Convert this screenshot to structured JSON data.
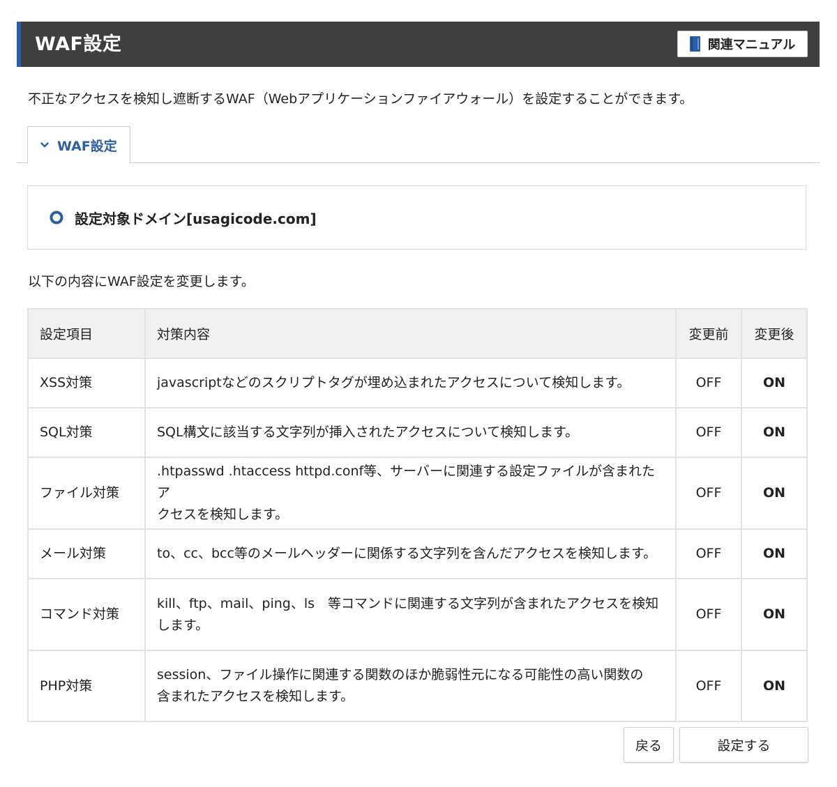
{
  "header": {
    "title": "WAF設定",
    "manual_button_label": "関連マニュアル",
    "manual_icon": "book-icon"
  },
  "description": "不正なアクセスを検知し遮断するWAF（Webアプリケーションファイアウォール）を設定することができます。",
  "tab": {
    "label": "WAF設定",
    "icon": "chevron-down-icon"
  },
  "domain": {
    "label": "設定対象ドメイン[usagicode.com]",
    "icon": "radio-icon"
  },
  "change_note": "以下の内容にWAF設定を変更します。",
  "table": {
    "headers": {
      "item": "設定項目",
      "content": "対策内容",
      "before": "変更前",
      "after": "変更後"
    },
    "rows": [
      {
        "item": "XSS対策",
        "content_lines": [
          "javascriptなどのスクリプトタグが埋め込まれたアクセスについて検知します。"
        ],
        "before": "OFF",
        "after": "ON"
      },
      {
        "item": "SQL対策",
        "content_lines": [
          "SQL構文に該当する文字列が挿入されたアクセスについて検知します。"
        ],
        "before": "OFF",
        "after": "ON"
      },
      {
        "item": "ファイル対策",
        "content_lines": [
          ".htpasswd .htaccess httpd.conf等、サーバーに関連する設定ファイルが含まれたア",
          "クセスを検知します。"
        ],
        "before": "OFF",
        "after": "ON"
      },
      {
        "item": "メール対策",
        "content_lines": [
          "to、cc、bcc等のメールヘッダーに関係する文字列を含んだアクセスを検知します。"
        ],
        "before": "OFF",
        "after": "ON"
      },
      {
        "item": "コマンド対策",
        "content_lines": [
          "kill、ftp、mail、ping、ls　等コマンドに関連する文字列が含まれたアクセスを検知",
          "します。"
        ],
        "before": "OFF",
        "after": "ON"
      },
      {
        "item": "PHP対策",
        "content_lines": [
          "session、ファイル操作に関連する関数のほか脆弱性元になる可能性の高い関数の",
          "含まれたアクセスを検知します。"
        ],
        "before": "OFF",
        "after": "ON"
      }
    ]
  },
  "buttons": {
    "back": "戻る",
    "submit": "設定する"
  },
  "colors": {
    "header_bg": "#3f3f3f",
    "accent": "#2a5ea8",
    "table_header_bg": "#f1f1f1",
    "border": "#e2e2e2"
  }
}
